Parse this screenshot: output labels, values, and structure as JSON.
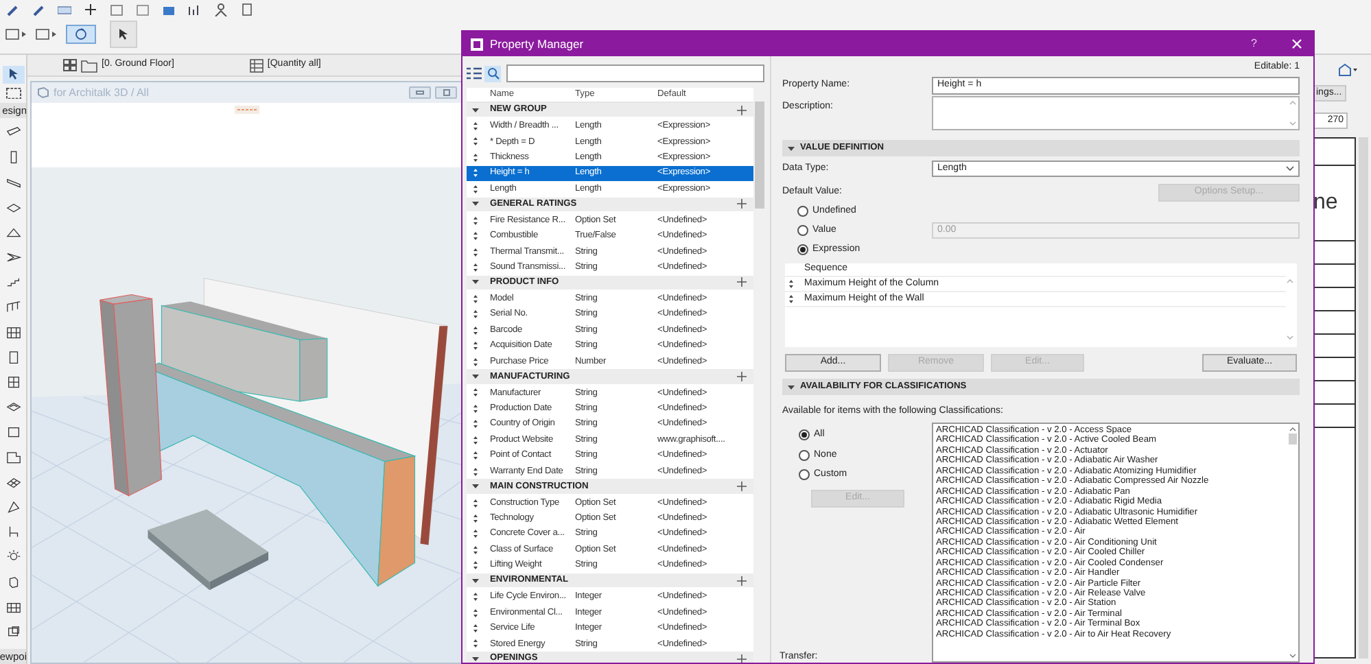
{
  "palette": {
    "labels": [
      "esign",
      "ewpoi"
    ]
  },
  "view_tabs": [
    {
      "label": "[0. Ground Floor]"
    },
    {
      "label": "[Quantity all]"
    }
  ],
  "view_window": {
    "title": "for Architalk 3D / All"
  },
  "background_app": {
    "button": "ings...",
    "field": "270",
    "text": "ne"
  },
  "dialog": {
    "title": "Property Manager",
    "help": "?"
  },
  "property_list": {
    "columns": [
      "Name",
      "Type",
      "Default"
    ],
    "groups": [
      {
        "name": "NEW GROUP",
        "expanded": true,
        "items": [
          {
            "name": "Width / Breadth ...",
            "type": "Length",
            "default": "<Expression>",
            "selected": false
          },
          {
            "name": "* Depth = D",
            "type": "Length",
            "default": "<Expression>",
            "selected": false
          },
          {
            "name": "Thickness",
            "type": "Length",
            "default": "<Expression>",
            "selected": false
          },
          {
            "name": "Height = h",
            "type": "Length",
            "default": "<Expression>",
            "selected": true
          },
          {
            "name": "Length",
            "type": "Length",
            "default": "<Expression>",
            "selected": false
          }
        ]
      },
      {
        "name": "GENERAL RATINGS",
        "expanded": true,
        "items": [
          {
            "name": "Fire Resistance R...",
            "type": "Option Set",
            "default": "<Undefined>",
            "selected": false
          },
          {
            "name": "Combustible",
            "type": "True/False",
            "default": "<Undefined>",
            "selected": false
          },
          {
            "name": "Thermal Transmit...",
            "type": "String",
            "default": "<Undefined>",
            "selected": false
          },
          {
            "name": "Sound Transmissi...",
            "type": "String",
            "default": "<Undefined>",
            "selected": false
          }
        ]
      },
      {
        "name": "PRODUCT INFO",
        "expanded": true,
        "items": [
          {
            "name": "Model",
            "type": "String",
            "default": "<Undefined>",
            "selected": false
          },
          {
            "name": "Serial No.",
            "type": "String",
            "default": "<Undefined>",
            "selected": false
          },
          {
            "name": "Barcode",
            "type": "String",
            "default": "<Undefined>",
            "selected": false
          },
          {
            "name": "Acquisition Date",
            "type": "String",
            "default": "<Undefined>",
            "selected": false
          },
          {
            "name": "Purchase Price",
            "type": "Number",
            "default": "<Undefined>",
            "selected": false
          }
        ]
      },
      {
        "name": "MANUFACTURING",
        "expanded": true,
        "items": [
          {
            "name": "Manufacturer",
            "type": "String",
            "default": "<Undefined>",
            "selected": false
          },
          {
            "name": "Production Date",
            "type": "String",
            "default": "<Undefined>",
            "selected": false
          },
          {
            "name": "Country of Origin",
            "type": "String",
            "default": "<Undefined>",
            "selected": false
          },
          {
            "name": "Product Website",
            "type": "String",
            "default": "www.graphisoft....",
            "selected": false
          },
          {
            "name": "Point of Contact",
            "type": "String",
            "default": "<Undefined>",
            "selected": false
          },
          {
            "name": "Warranty End Date",
            "type": "String",
            "default": "<Undefined>",
            "selected": false
          }
        ]
      },
      {
        "name": "MAIN CONSTRUCTION",
        "expanded": true,
        "items": [
          {
            "name": "Construction Type",
            "type": "Option Set",
            "default": "<Undefined>",
            "selected": false
          },
          {
            "name": "Technology",
            "type": "Option Set",
            "default": "<Undefined>",
            "selected": false
          },
          {
            "name": "Concrete Cover a...",
            "type": "String",
            "default": "<Undefined>",
            "selected": false
          },
          {
            "name": "Class of Surface",
            "type": "Option Set",
            "default": "<Undefined>",
            "selected": false
          },
          {
            "name": "Lifting Weight",
            "type": "String",
            "default": "<Undefined>",
            "selected": false
          }
        ]
      },
      {
        "name": "ENVIRONMENTAL",
        "expanded": true,
        "items": [
          {
            "name": "Life Cycle Environ...",
            "type": "Integer",
            "default": "<Undefined>",
            "selected": false
          },
          {
            "name": "Environmental Cl...",
            "type": "Integer",
            "default": "<Undefined>",
            "selected": false
          },
          {
            "name": "Service Life",
            "type": "Integer",
            "default": "<Undefined>",
            "selected": false
          },
          {
            "name": "Stored Energy",
            "type": "String",
            "default": "<Undefined>",
            "selected": false
          }
        ]
      },
      {
        "name": "OPENINGS",
        "expanded": true
      }
    ]
  },
  "details": {
    "editable": "Editable: 1",
    "property_name_label": "Property Name:",
    "property_name": "Height = h",
    "description_label": "Description:",
    "value_definition": {
      "header": "VALUE DEFINITION",
      "expanded": true,
      "data_type_label": "Data Type:",
      "data_type": "Length",
      "default_value_label": "Default Value:",
      "options_button": {
        "label": "Options Setup...",
        "disabled": true
      },
      "options": [
        {
          "label": "Undefined",
          "selected": false
        },
        {
          "label": "Value",
          "selected": false
        },
        {
          "label": "Expression",
          "selected": true
        }
      ],
      "value_field": "0.00",
      "sequence_header": "Sequence",
      "sequence": [
        "Maximum Height of the Column",
        "Maximum Height of the Wall"
      ],
      "buttons": [
        {
          "label": "Add...",
          "disabled": false
        },
        {
          "label": "Remove",
          "disabled": true
        },
        {
          "label": "Edit...",
          "disabled": true
        },
        {
          "label": "Evaluate...",
          "disabled": false
        }
      ]
    },
    "availability": {
      "header": "AVAILABILITY FOR CLASSIFICATIONS",
      "expanded": true,
      "caption": "Available for items with the following Classifications:",
      "options": [
        {
          "label": "All",
          "selected": true
        },
        {
          "label": "None",
          "selected": false
        },
        {
          "label": "Custom",
          "selected": false
        }
      ],
      "edit_button": {
        "label": "Edit...",
        "disabled": true
      },
      "classifications": [
        {
          "label": "ARCHICAD Classification - v 2.0 - Access Space",
          "selected": false
        },
        {
          "label": "ARCHICAD Classification - v 2.0 - Active Cooled Beam",
          "selected": false
        },
        {
          "label": "ARCHICAD Classification - v 2.0 - Actuator",
          "selected": false
        },
        {
          "label": "ARCHICAD Classification - v 2.0 - Adiabatic Air Washer",
          "selected": false
        },
        {
          "label": "ARCHICAD Classification - v 2.0 - Adiabatic Atomizing Humidifier",
          "selected": false
        },
        {
          "label": "ARCHICAD Classification - v 2.0 - Adiabatic Compressed Air Nozzle",
          "selected": false
        },
        {
          "label": "ARCHICAD Classification - v 2.0 - Adiabatic Pan",
          "selected": false
        },
        {
          "label": "ARCHICAD Classification - v 2.0 - Adiabatic Rigid Media",
          "selected": false
        },
        {
          "label": "ARCHICAD Classification - v 2.0 - Adiabatic Ultrasonic Humidifier",
          "selected": false
        },
        {
          "label": "ARCHICAD Classification - v 2.0 - Adiabatic Wetted Element",
          "selected": false
        },
        {
          "label": "ARCHICAD Classification - v 2.0 - Air",
          "selected": false
        },
        {
          "label": "ARCHICAD Classification - v 2.0 - Air Conditioning Unit",
          "selected": false
        },
        {
          "label": "ARCHICAD Classification - v 2.0 - Air Cooled Chiller",
          "selected": false
        },
        {
          "label": "ARCHICAD Classification - v 2.0 - Air Cooled Condenser",
          "selected": false
        },
        {
          "label": "ARCHICAD Classification - v 2.0 - Air Handler",
          "selected": false
        },
        {
          "label": "ARCHICAD Classification - v 2.0 - Air Particle Filter",
          "selected": false
        },
        {
          "label": "ARCHICAD Classification - v 2.0 - Air Release Valve",
          "selected": false
        },
        {
          "label": "ARCHICAD Classification - v 2.0 - Air Station",
          "selected": false
        },
        {
          "label": "ARCHICAD Classification - v 2.0 - Air Terminal",
          "selected": false
        },
        {
          "label": "ARCHICAD Classification - v 2.0 - Air Terminal Box",
          "selected": false
        },
        {
          "label": "ARCHICAD Classification - v 2.0 - Air to Air Heat Recovery",
          "selected": false
        }
      ],
      "transfer_label": "Transfer:"
    }
  }
}
